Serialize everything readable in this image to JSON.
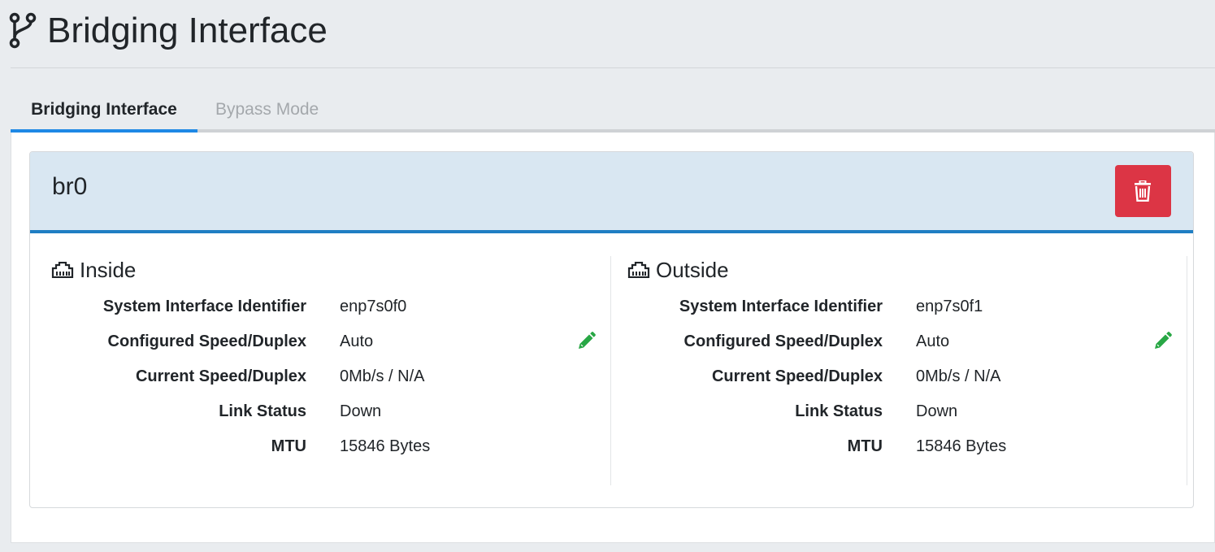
{
  "page": {
    "title": "Bridging Interface",
    "title_icon": "code-branch-icon"
  },
  "tabs": [
    {
      "label": "Bridging Interface",
      "active": true
    },
    {
      "label": "Bypass Mode",
      "active": false
    }
  ],
  "bridge": {
    "name": "br0",
    "delete_icon": "trash-icon",
    "delete_color": "#dc3545",
    "header_color": "#d9e7f2",
    "accent_color": "#1f7ec3"
  },
  "field_labels": {
    "system_interface_identifier": "System Interface Identifier",
    "configured_speed_duplex": "Configured Speed/Duplex",
    "current_speed_duplex": "Current Speed/Duplex",
    "link_status": "Link Status",
    "mtu": "MTU"
  },
  "inside": {
    "title": "Inside",
    "icon": "ethernet-port-icon",
    "system_interface_identifier": "enp7s0f0",
    "configured_speed_duplex": "Auto",
    "current_speed_duplex": "0Mb/s / N/A",
    "link_status": "Down",
    "mtu": "15846 Bytes",
    "edit_icon": "pencil-icon"
  },
  "outside": {
    "title": "Outside",
    "icon": "ethernet-port-icon",
    "system_interface_identifier": "enp7s0f1",
    "configured_speed_duplex": "Auto",
    "current_speed_duplex": "0Mb/s / N/A",
    "link_status": "Down",
    "mtu": "15846 Bytes",
    "edit_icon": "pencil-icon"
  },
  "colors": {
    "edit_icon": "#28a745",
    "tab_active_underline": "#1e88e5"
  }
}
